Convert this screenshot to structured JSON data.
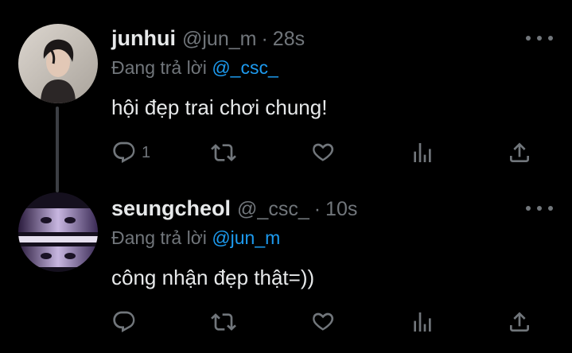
{
  "tweets": [
    {
      "name": "junhui",
      "handle": "@jun_m",
      "separator": "·",
      "time": "28s",
      "replying_prefix": "Đang trả lời",
      "replying_to": "@_csc_",
      "text": "hội đẹp trai chơi chung!",
      "reply_count": "1",
      "retweet_count": "",
      "like_count": "",
      "avatar_icon": "avatar-photo"
    },
    {
      "name": "seungcheol",
      "handle": "@_csc_",
      "separator": "·",
      "time": "10s",
      "replying_prefix": "Đang trả lời",
      "replying_to": "@jun_m",
      "text": "công nhận đẹp thật=))",
      "reply_count": "",
      "retweet_count": "",
      "like_count": "",
      "avatar_icon": "avatar-photo"
    }
  ],
  "colors": {
    "background": "#000000",
    "text": "#e7e9ea",
    "secondary": "#71767b",
    "accent": "#1d9bf0",
    "thread_line": "#3c3f44"
  },
  "icons": [
    "reply-icon",
    "retweet-icon",
    "like-icon",
    "analytics-icon",
    "share-icon",
    "more-options-icon"
  ]
}
